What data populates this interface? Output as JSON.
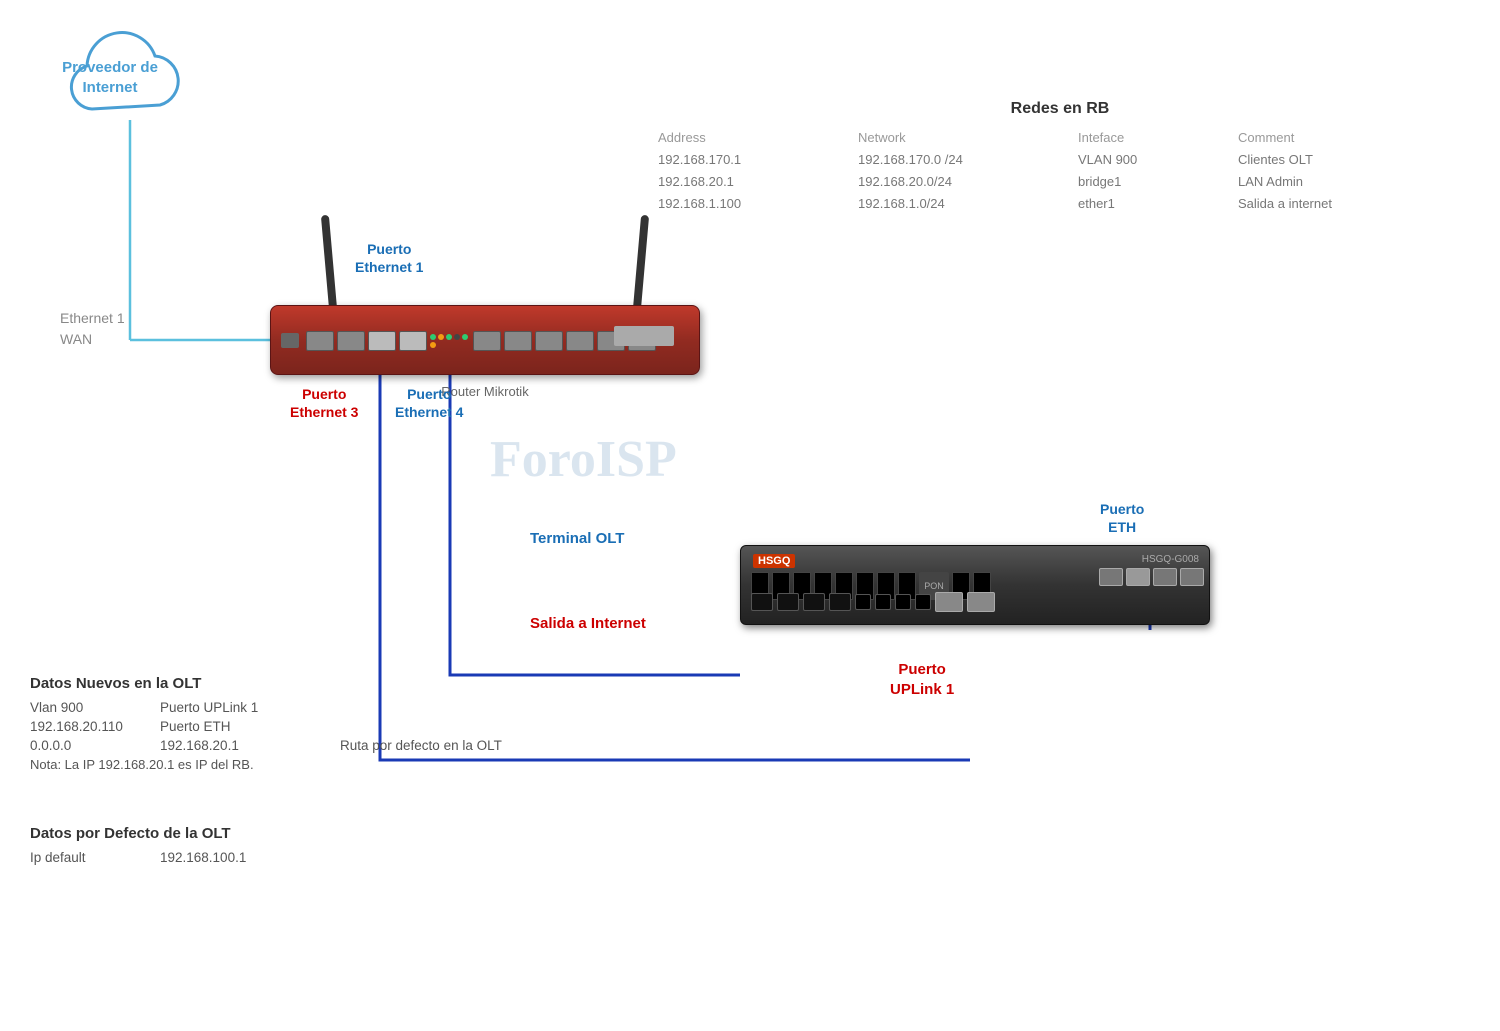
{
  "cloud": {
    "label_line1": "Proveedor de",
    "label_line2": "Internet"
  },
  "ethernet_wan": {
    "line1": "Ethernet 1",
    "line2": "WAN"
  },
  "router": {
    "label": "Router Mikrotik"
  },
  "port_labels": {
    "eth1_line1": "Puerto",
    "eth1_line2": "Ethernet 1",
    "eth3_line1": "Puerto",
    "eth3_line2": "Ethernet 3",
    "eth4_line1": "Puerto",
    "eth4_line2": "Ethernet 4"
  },
  "olt": {
    "brand": "HSGQ",
    "model": "HSGQ-G008",
    "port_eth_line1": "Puerto",
    "port_eth_line2": "ETH",
    "port_uplink_line1": "Puerto",
    "port_uplink_line2": "UPLink 1"
  },
  "connection_labels": {
    "terminal_olt": "Terminal OLT",
    "salida_internet": "Salida a Internet"
  },
  "redes_rb": {
    "title": "Redes en RB",
    "headers": [
      "Address",
      "Network",
      "Inteface",
      "Comment"
    ],
    "rows": [
      [
        "192.168.170.1",
        "192.168.170.0 /24",
        "VLAN 900",
        "Clientes OLT"
      ],
      [
        "192.168.20.1",
        "192.168.20.0/24",
        "bridge1",
        "LAN Admin"
      ],
      [
        "192.168.1.100",
        "192.168.1.0/24",
        "ether1",
        "Salida a internet"
      ]
    ]
  },
  "datos_nuevos": {
    "title": "Datos Nuevos en  la OLT",
    "rows": [
      {
        "col1": "Vlan 900",
        "col2": "Puerto UPLink 1",
        "col3": ""
      },
      {
        "col1": "192.168.20.110",
        "col2": "Puerto ETH",
        "col3": ""
      },
      {
        "col1": "0.0.0.0",
        "col2": "192.168.20.1",
        "col3": "Ruta  por defecto en la OLT"
      }
    ],
    "nota": "Nota: La IP 192.168.20.1 es IP del RB."
  },
  "datos_defecto": {
    "title": "Datos por Defecto de la OLT",
    "rows": [
      {
        "col1": "Ip default",
        "col2": "192.168.100.1"
      }
    ]
  },
  "watermark": "ForoISP"
}
